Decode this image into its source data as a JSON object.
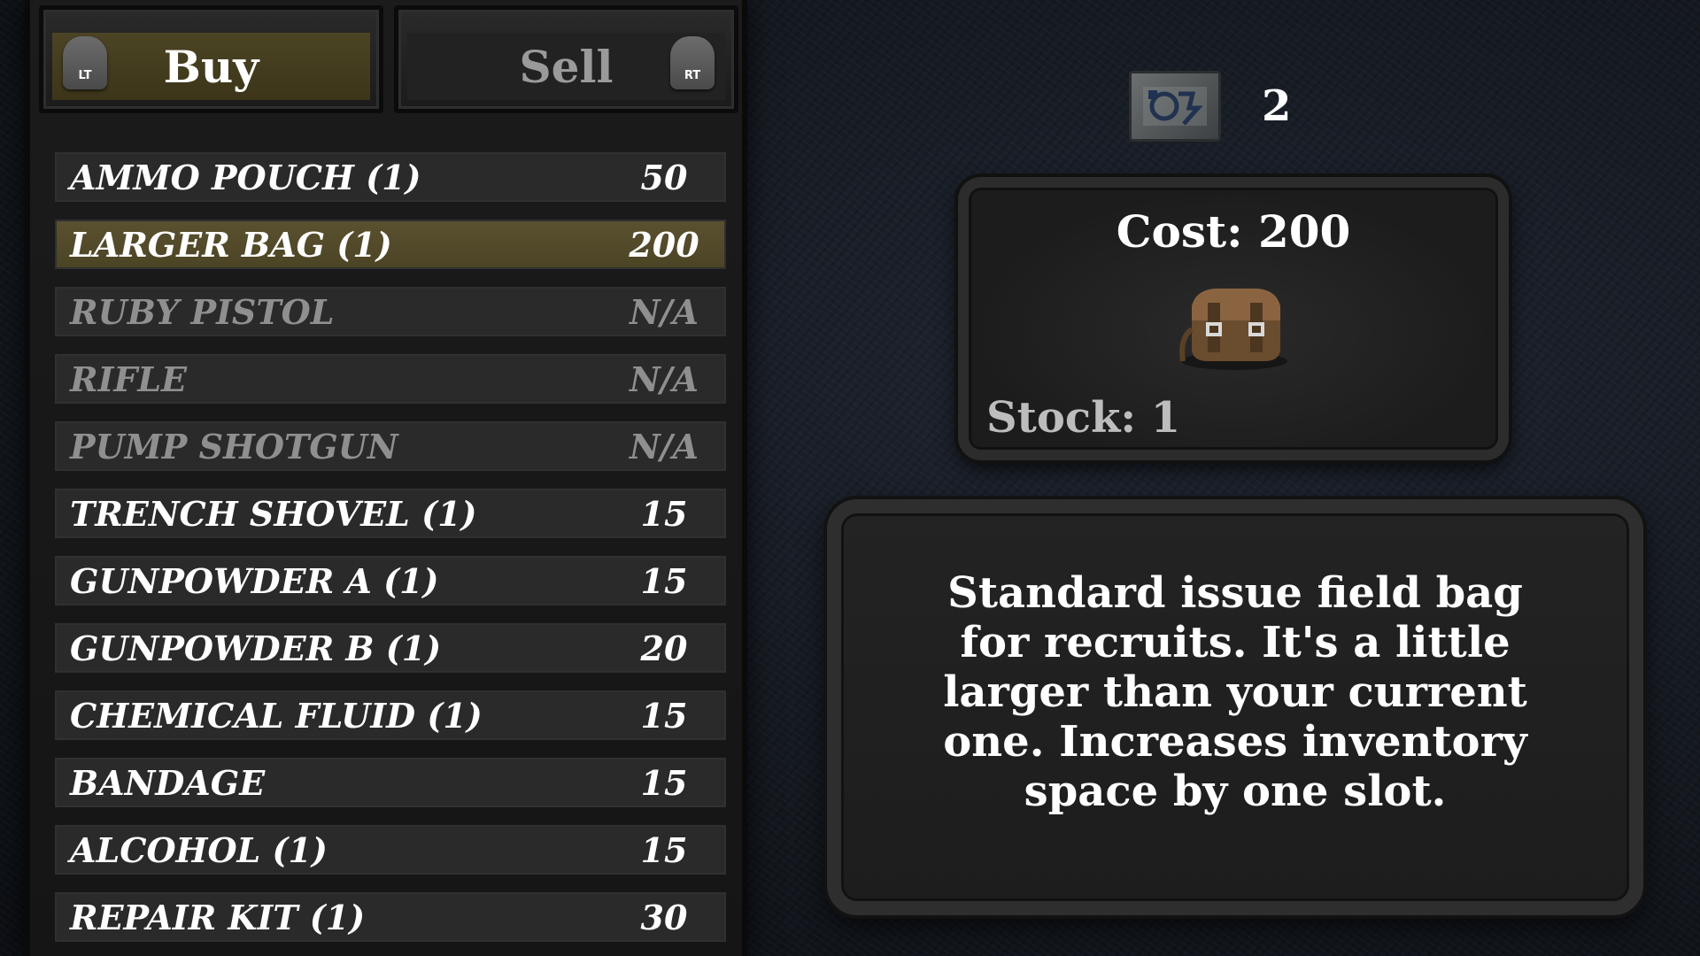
{
  "tabs": {
    "buy_label": "Buy",
    "sell_label": "Sell",
    "left_trigger": "LT",
    "right_trigger": "RT",
    "active": "Buy"
  },
  "items": [
    {
      "name": "AMMO POUCH  (1)",
      "price": "50",
      "state": "available"
    },
    {
      "name": "LARGER BAG  (1)",
      "price": "200",
      "state": "selected"
    },
    {
      "name": "RUBY PISTOL",
      "price": "N/A",
      "state": "unavailable"
    },
    {
      "name": "RIFLE",
      "price": "N/A",
      "state": "unavailable"
    },
    {
      "name": "PUMP SHOTGUN",
      "price": "N/A",
      "state": "unavailable"
    },
    {
      "name": "TRENCH SHOVEL  (1)",
      "price": "15",
      "state": "available"
    },
    {
      "name": "GUNPOWDER A  (1)",
      "price": "15",
      "state": "available"
    },
    {
      "name": "GUNPOWDER B  (1)",
      "price": "20",
      "state": "available"
    },
    {
      "name": "CHEMICAL FLUID  (1)",
      "price": "15",
      "state": "available"
    },
    {
      "name": "BANDAGE",
      "price": "15",
      "state": "available"
    },
    {
      "name": "ALCOHOL  (1)",
      "price": "15",
      "state": "available"
    },
    {
      "name": "REPAIR KIT  (1)",
      "price": "30",
      "state": "available"
    }
  ],
  "currency": {
    "icon": "trade-token-icon",
    "value": "2"
  },
  "detail": {
    "cost": "Cost: 200",
    "stock": "Stock: 1",
    "icon": "field-bag-icon",
    "description": "Standard issue field bag for recruits. It's a little larger than your current one. Increases inventory space by one slot."
  },
  "colors": {
    "selected_row": "#4b4424",
    "row": "#2a2a2a",
    "unavailable_text": "#8f8f8f"
  }
}
